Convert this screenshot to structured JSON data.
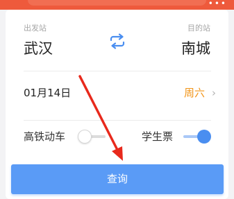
{
  "header": {
    "more_icon": "more-dots-icon",
    "more_text": "•••",
    "accent_color": "#ee5a3c"
  },
  "route": {
    "departure_label": "出发站",
    "departure_city": "武汉",
    "destination_label": "目的站",
    "destination_city": "南城",
    "swap_icon": "swap-arrows-icon"
  },
  "date": {
    "value": "01月14日",
    "weekday": "周六",
    "chevron": "›",
    "weekday_color": "#f29417"
  },
  "options": {
    "high_speed_label": "高铁动车",
    "high_speed_on": false,
    "student_label": "学生票",
    "student_on": true,
    "toggle_on_color": "#4a8ef0"
  },
  "search": {
    "label": "查询",
    "color": "#5a9bf6"
  },
  "annotation": {
    "arrow_color": "#e8291c"
  }
}
